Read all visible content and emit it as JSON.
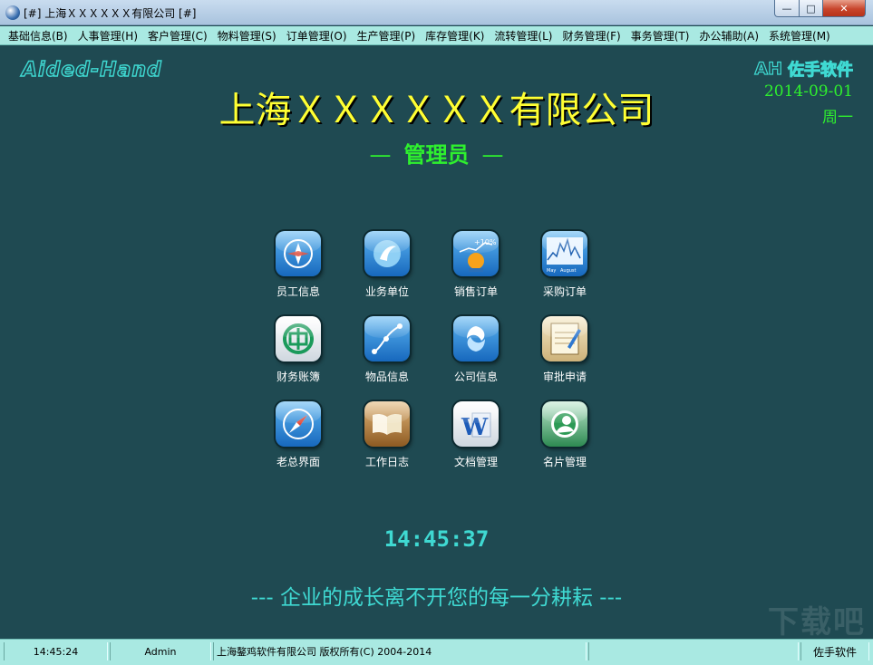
{
  "window": {
    "title": "[#] 上海ＸＸＸＸＸＸ有限公司 [#]",
    "minimize_glyph": "—",
    "maximize_glyph": "□",
    "close_glyph": "✕"
  },
  "menu": [
    "基础信息(B)",
    "人事管理(H)",
    "客户管理(C)",
    "物料管理(S)",
    "订单管理(O)",
    "生产管理(P)",
    "库存管理(K)",
    "流转管理(L)",
    "财务管理(F)",
    "事务管理(T)",
    "办公辅助(A)",
    "系统管理(M)"
  ],
  "header": {
    "logo_left": "Aided-Hand",
    "logo_badge": "AH",
    "brand_name": "佐手软件",
    "date": "2014-09-01",
    "weekday": "周一",
    "company": "上海ＸＸＸＸＸＸ有限公司",
    "role_dash_left": "—",
    "role": "管理员",
    "role_dash_right": "—"
  },
  "tiles": [
    {
      "label": "员工信息",
      "icon": "compass-icon"
    },
    {
      "label": "业务单位",
      "icon": "bird-icon"
    },
    {
      "label": "销售订单",
      "icon": "sales-chart-icon",
      "badge": "+10%"
    },
    {
      "label": "采购订单",
      "icon": "stock-chart-icon",
      "axis_a": "May",
      "axis_b": "August"
    },
    {
      "label": "财务账簿",
      "icon": "bank-icon"
    },
    {
      "label": "物品信息",
      "icon": "graph-curve-icon"
    },
    {
      "label": "公司信息",
      "icon": "swirl-icon"
    },
    {
      "label": "审批申请",
      "icon": "notepad-icon"
    },
    {
      "label": "老总界面",
      "icon": "safari-icon"
    },
    {
      "label": "工作日志",
      "icon": "book-icon"
    },
    {
      "label": "文档管理",
      "icon": "word-icon",
      "glyph": "W"
    },
    {
      "label": "名片管理",
      "icon": "contact-icon"
    }
  ],
  "clock": "14:45:37",
  "slogan": "---  企业的成长离不开您的每一分耕耘  ---",
  "watermark": "下载吧",
  "status": {
    "time": "14:45:24",
    "user": "Admin",
    "copyright": "上海鏊鸡软件有限公司 版权所有(C) 2004-2014",
    "empty": "",
    "brand": "佐手软件"
  },
  "colors": {
    "background": "#1f4a52",
    "menubar": "#a9e9e2",
    "company_title": "#ffff33",
    "green_text": "#2ef02e",
    "cyan_text": "#3fd9d2"
  }
}
